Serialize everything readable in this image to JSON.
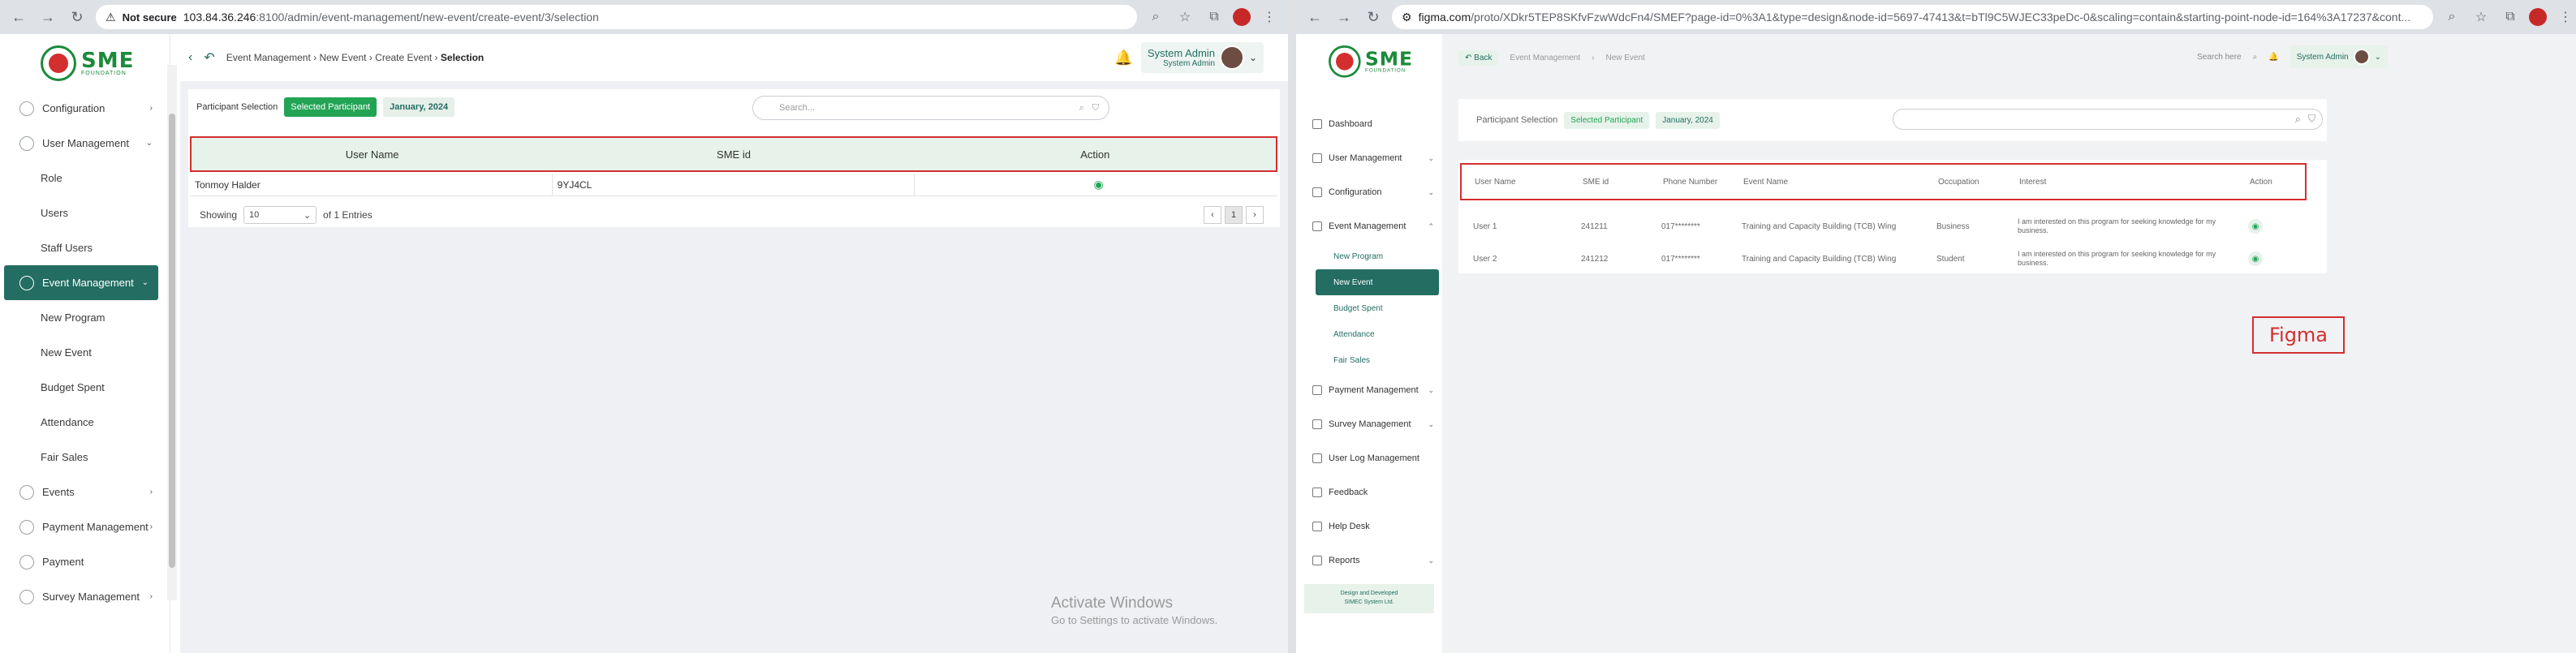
{
  "left": {
    "browser": {
      "security_label": "Not secure",
      "url_host": "103.84.36.246",
      "url_rest": ":8100/admin/event-management/new-event/create-event/3/selection"
    },
    "logo": {
      "text": "SME",
      "sub": "FOUNDATION"
    },
    "sidebar": {
      "items": [
        {
          "label": "Configuration",
          "icon": "gear-icon"
        },
        {
          "label": "User Management",
          "icon": "user-icon"
        },
        {
          "label": "Role"
        },
        {
          "label": "Users"
        },
        {
          "label": "Staff Users"
        },
        {
          "label": "Event Management",
          "icon": "calendar-icon"
        },
        {
          "label": "New Program"
        },
        {
          "label": "New Event"
        },
        {
          "label": "Budget Spent"
        },
        {
          "label": "Attendance"
        },
        {
          "label": "Fair Sales"
        },
        {
          "label": "Events",
          "icon": "event-icon"
        },
        {
          "label": "Payment Management",
          "icon": "payment-icon"
        },
        {
          "label": "Payment",
          "icon": "wallet-icon"
        },
        {
          "label": "Survey Management",
          "icon": "survey-icon"
        }
      ]
    },
    "breadcrumb": [
      "Event Management",
      "New Event",
      "Create Event",
      "Selection"
    ],
    "user": {
      "name": "System Admin",
      "role": "System Admin"
    },
    "filters": {
      "label": "Participant Selection",
      "selected": "Selected Participant",
      "date": "January, 2024",
      "search_placeholder": "Search..."
    },
    "table": {
      "headers": [
        "User Name",
        "SME id",
        "Action"
      ],
      "rows": [
        {
          "name": "Tonmoy Halder",
          "sme_id": "9YJ4CL"
        }
      ]
    },
    "pager": {
      "showing": "Showing",
      "per_page": "10",
      "entries": "of 1 Entries",
      "current": "1"
    },
    "watermark": {
      "line1": "Activate Windows",
      "line2": "Go to Settings to activate Windows."
    }
  },
  "right": {
    "browser": {
      "url_host": "figma.com",
      "url_rest": "/proto/XDkr5TEP8SKfvFzwWdcFn4/SMEF?page-id=0%3A1&type=design&node-id=5697-47413&t=bTl9C5WJEC33peDc-0&scaling=contain&starting-point-node-id=164%3A17237&cont..."
    },
    "sidebar": {
      "items": [
        {
          "label": "Dashboard"
        },
        {
          "label": "User Management"
        },
        {
          "label": "Configuration"
        },
        {
          "label": "Event Management"
        }
      ],
      "subitems": [
        "New Program",
        "New Event",
        "Budget Spent",
        "Attendance",
        "Fair Sales"
      ],
      "items2": [
        {
          "label": "Payment Management"
        },
        {
          "label": "Survey Management"
        },
        {
          "label": "User Log Management"
        },
        {
          "label": "Feedback"
        },
        {
          "label": "Help Desk"
        },
        {
          "label": "Reports"
        }
      ],
      "credit_line1": "Design and Developed",
      "credit_line2": "SIMEC System Ltd."
    },
    "top": {
      "back": "Back",
      "crumb1": "Event Management",
      "crumb2": "New Event",
      "search_here": "Search here",
      "user": "System Admin"
    },
    "filters": {
      "label": "Participant Selection",
      "selected": "Selected Participant",
      "date": "January, 2024"
    },
    "table": {
      "headers": [
        "User Name",
        "SME id",
        "Phone Number",
        "Event Name",
        "Occupation",
        "Interest",
        "Action"
      ],
      "rows": [
        {
          "name": "User 1",
          "sme_id": "241211",
          "phone": "017********",
          "event": "Training and Capacity Building (TCB) Wing",
          "occupation": "Business",
          "interest": "I am interested on this program for seeking knowledge for my business."
        },
        {
          "name": "User 2",
          "sme_id": "241212",
          "phone": "017********",
          "event": "Training and Capacity Building (TCB) Wing",
          "occupation": "Student",
          "interest": "I am interested on this program for seeking knowledge for my business."
        }
      ]
    },
    "annotation": "Figma"
  }
}
